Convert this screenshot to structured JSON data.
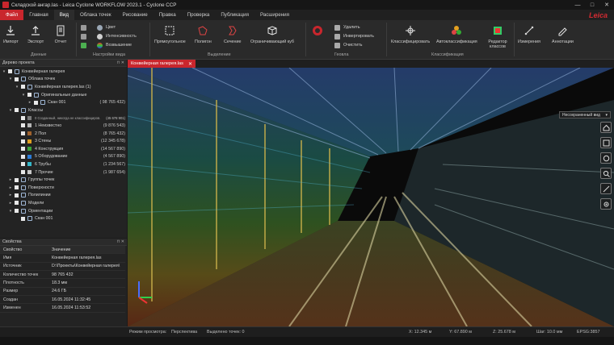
{
  "window": {
    "title": "Складской ангар.las - Leica Cyclone WORKFLOW 2023.1 - Cyclone CCP",
    "minimize": "—",
    "maximize": "□",
    "close": "✕"
  },
  "menu": {
    "tabs": [
      "Файл",
      "Главная",
      "Вид",
      "Облака точек",
      "Рисование",
      "Правка",
      "Проверка",
      "Публикация",
      "Расширения"
    ],
    "logo": "Leica"
  },
  "ribbon": {
    "data": {
      "import": "Импорт",
      "export": "Экспорт",
      "report": "Отчет",
      "group": "Данные"
    },
    "view": {
      "color": "Цвет",
      "intensity": "Интенсивность",
      "elevation": "Возвышение",
      "group": "Настройки вида"
    },
    "select": {
      "rectangle": "Прямоугольное",
      "polygon": "Полигон",
      "section": "Сечение",
      "cube": "Ограничивающий куб",
      "group": "Выделение"
    },
    "fence": {
      "delete": "Удалить",
      "invert": "Инвертировать",
      "clear": "Очистить",
      "group": "Геовла"
    },
    "classify": {
      "classify": "Классифицировать",
      "auto": "Автоклассификация",
      "editor": "Редактор классов",
      "group": "Классификация"
    },
    "tools": {
      "measure": "Измерения",
      "annotate": "Аннотации"
    }
  },
  "tree": {
    "title": "Дерево проекта",
    "rows": [
      {
        "label": "Конвейерная галерея",
        "level": 0,
        "exp": "▾"
      },
      {
        "label": "Облака точек",
        "level": 1,
        "exp": "▾"
      },
      {
        "label": "Конвейерная галерея.las (1)",
        "level": 2,
        "exp": "▾"
      },
      {
        "label": "Оригинальные данные",
        "level": 3,
        "exp": "▾"
      },
      {
        "label": "Скан 001",
        "level": 4,
        "exp": "▸",
        "count": "( 98 765 432)"
      },
      {
        "label": "Классы",
        "level": 1,
        "exp": "▾"
      },
      {
        "label": "0  Созданный, никогда не классифициров.",
        "level": 2,
        "count": "(45 678 901)",
        "color": "#7a7a7a"
      },
      {
        "label": "1  Неизвестно",
        "level": 2,
        "count": "(9 876 543)",
        "color": "#b8b8b8"
      },
      {
        "label": "2  Пол",
        "level": 2,
        "count": "(8 765 432)",
        "color": "#a0622d"
      },
      {
        "label": "3  Стены",
        "level": 2,
        "count": "(12 345 678)",
        "color": "#e0a020"
      },
      {
        "label": "4  Конструкция",
        "level": 2,
        "count": "(14 567 890)",
        "color": "#3aa23a"
      },
      {
        "label": "5  Оборудование",
        "level": 2,
        "count": "(4 567 890)",
        "color": "#2b7bd6"
      },
      {
        "label": "6  Трубы",
        "level": 2,
        "count": "(1 234 567)",
        "color": "#35b7c9"
      },
      {
        "label": "7  Прочие",
        "level": 2,
        "count": "(1 987 654)",
        "color": "#c9c9c9"
      },
      {
        "label": "Группы точек",
        "level": 1,
        "exp": "▸"
      },
      {
        "label": "Поверхности",
        "level": 1,
        "exp": "▸"
      },
      {
        "label": "Полилинии",
        "level": 1,
        "exp": "▸"
      },
      {
        "label": "Модели",
        "level": 1,
        "exp": "▸"
      },
      {
        "label": "Ориентации",
        "level": 1,
        "exp": "▾"
      },
      {
        "label": "Скан 001",
        "level": 2
      }
    ]
  },
  "properties": {
    "title": "Свойства",
    "header_key": "Свойство",
    "header_val": "Значение",
    "rows": [
      {
        "k": "Имя",
        "v": "Конвейерная галерея.las"
      },
      {
        "k": "Источник",
        "v": "D:\\Проекты\\Конвейерная галерея\\"
      },
      {
        "k": "Количество точек",
        "v": "98 765 432"
      },
      {
        "k": "Плотность",
        "v": "18.3 мм"
      },
      {
        "k": "Размер",
        "v": "24.6 ГБ"
      },
      {
        "k": "Создан",
        "v": "16.05.2024 11:32:45"
      },
      {
        "k": "Изменен",
        "v": "16.05.2024 11:53:52"
      }
    ]
  },
  "document": {
    "tab": "Конвейерная галерея.las",
    "close": "✕"
  },
  "viewport": {
    "view_dropdown": "Несохраненный вид"
  },
  "status": {
    "mode_label": "Режим просмотра:",
    "mode_value": "Перспектива",
    "selected": "Выделено точек:  0",
    "x": "X:  12.345 м",
    "y": "Y:  67.890 м",
    "z": "Z:  25.678 м",
    "step": "Шаг:  10.0 мм",
    "epsg": "EPSG:3857"
  },
  "colors": {
    "accent": "#c9262d"
  }
}
